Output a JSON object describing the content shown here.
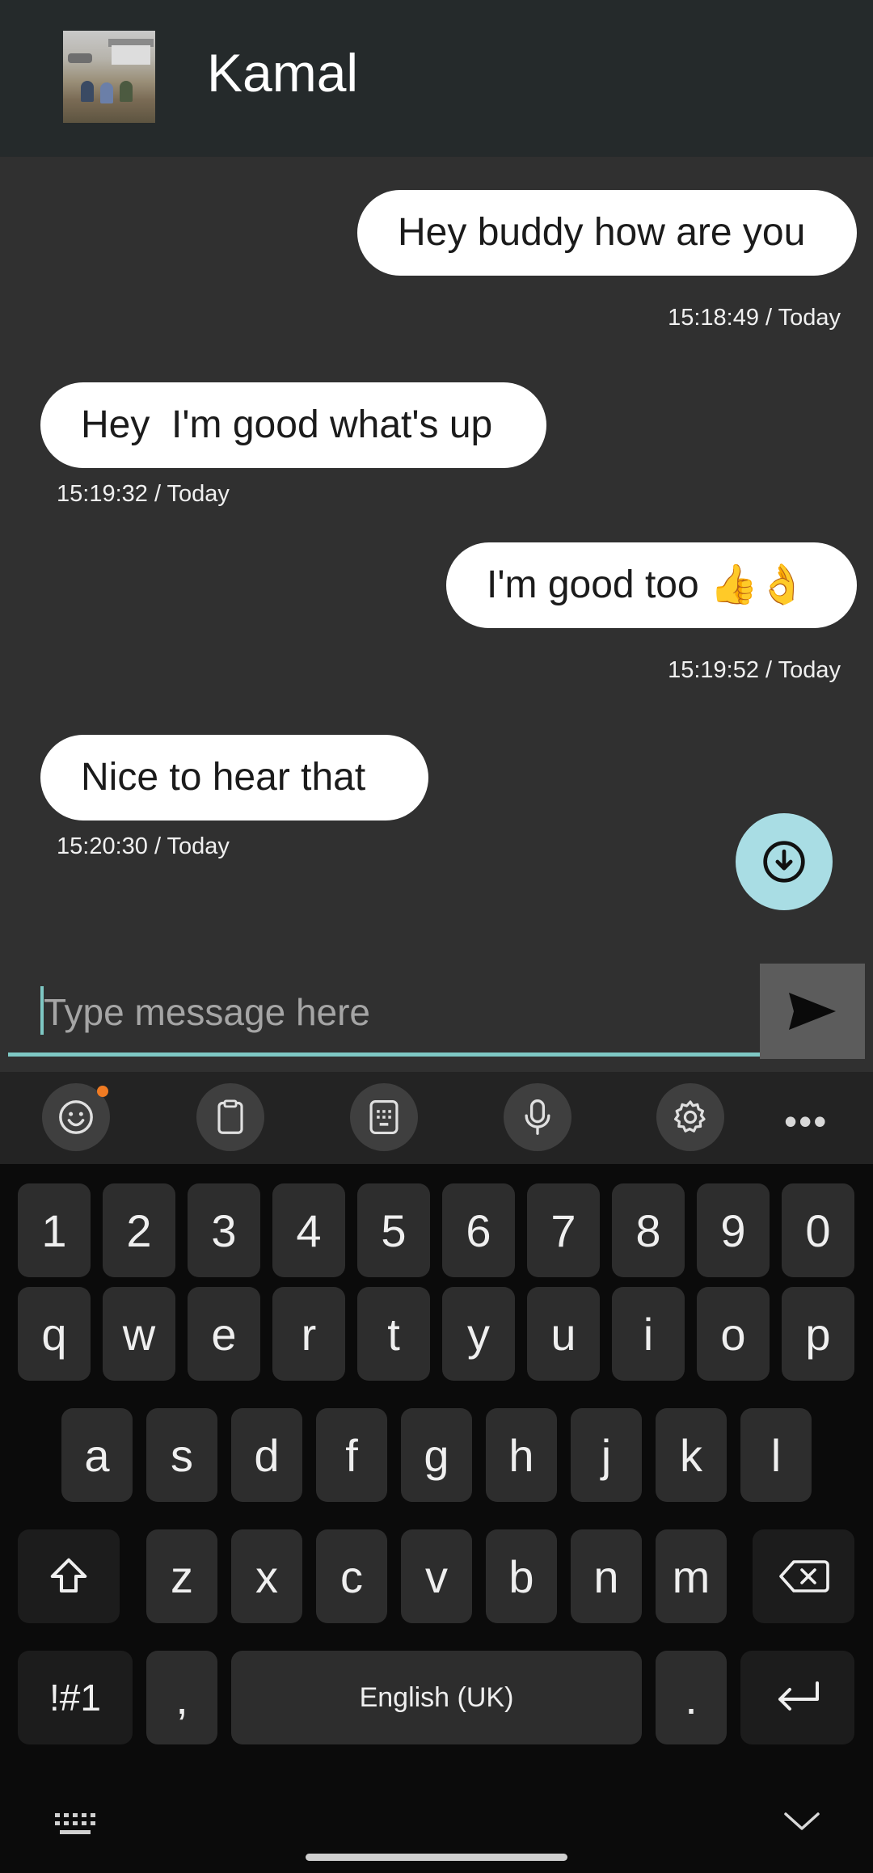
{
  "header": {
    "contact_name": "Kamal",
    "avatar_icon": "contact-photo"
  },
  "messages": [
    {
      "side": "sent",
      "text": "Hey buddy how are you",
      "time": "15:18:49 / Today"
    },
    {
      "side": "received",
      "text": "Hey  I'm good what's up",
      "time": "15:19:32 / Today"
    },
    {
      "side": "sent",
      "text": "I'm good too 👍👌",
      "time": "15:19:52 / Today"
    },
    {
      "side": "received",
      "text": "Nice to hear that",
      "time": "15:20:30 / Today"
    }
  ],
  "scroll_down_icon": "arrow-down-circle-icon",
  "composer": {
    "placeholder": "Type message here",
    "value": "",
    "send_icon": "send-icon"
  },
  "keyboard_toolbar": {
    "icons": [
      "emoji-icon",
      "clipboard-icon",
      "keypad-icon",
      "microphone-icon",
      "gear-icon",
      "more-icon"
    ],
    "more_label": "•••"
  },
  "keyboard": {
    "number_row": [
      "1",
      "2",
      "3",
      "4",
      "5",
      "6",
      "7",
      "8",
      "9",
      "0"
    ],
    "row1": [
      "q",
      "w",
      "e",
      "r",
      "t",
      "y",
      "u",
      "i",
      "o",
      "p"
    ],
    "row2": [
      "a",
      "s",
      "d",
      "f",
      "g",
      "h",
      "j",
      "k",
      "l"
    ],
    "row3": [
      "z",
      "x",
      "c",
      "v",
      "b",
      "n",
      "m"
    ],
    "symbols_key": "!#1",
    "comma_key": ",",
    "space_label": "English (UK)",
    "period_key": ".",
    "shift_icon": "shift-icon",
    "backspace_icon": "backspace-icon",
    "enter_icon": "enter-icon",
    "hide_keyboard_icon": "keyboard-icon",
    "collapse_icon": "chevron-down-icon"
  },
  "colors": {
    "header_bg": "#252a2b",
    "chat_bg": "#303030",
    "bubble_bg": "#ffffff",
    "accent": "#7ec8c4",
    "fab_bg": "#a9dde4",
    "keyboard_bg": "#0b0b0b",
    "key_bg": "#2d2d2d"
  }
}
